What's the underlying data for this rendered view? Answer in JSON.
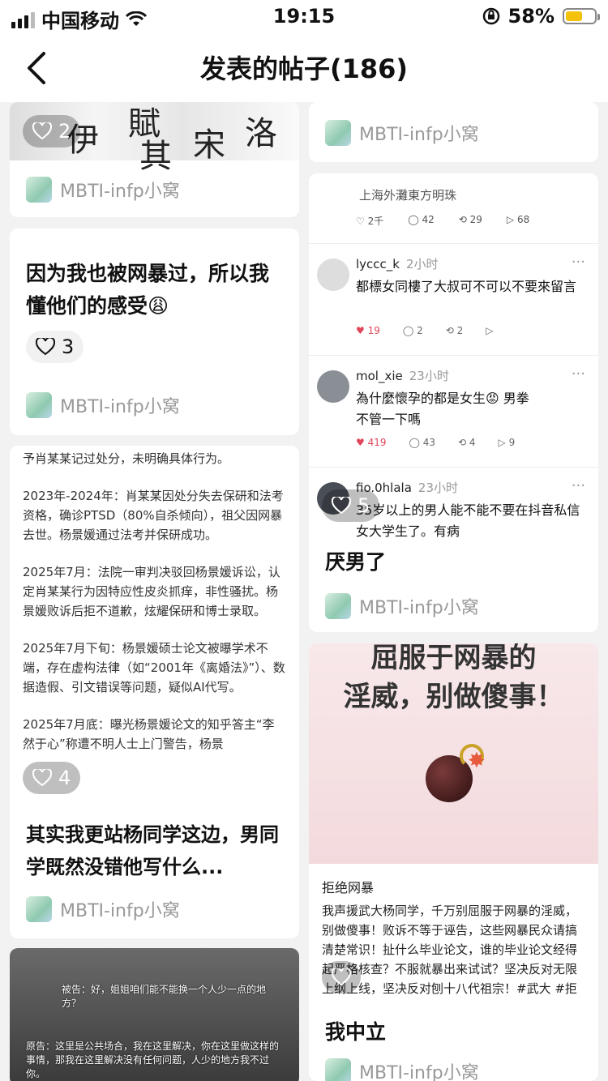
{
  "status": {
    "carrier": "中国移动",
    "time": "19:15",
    "battery": "58%",
    "battery_level": 0.58
  },
  "nav": {
    "title": "发表的帖子(186)"
  },
  "author": "MBTI-infp小窝",
  "left": {
    "card1": {
      "likes": "2",
      "calli": [
        "伊",
        "賦",
        "其",
        "宋",
        "洛"
      ]
    },
    "card2": {
      "title": "因为我也被网暴过，所以我懂他们的感受😩",
      "likes": "3"
    },
    "card3": {
      "doc": [
        "予肖某某记过处分，未明确具体行为。",
        "2023年-2024年：肖某某因处分失去保研和法考资格，确诊PTSD（80%自杀倾向），祖父因网暴去世。杨景媛通过法考并保研成功。",
        "2025年7月：法院一审判决驳回杨景媛诉讼，认定肖某某行为因特应性皮炎抓痒，非性骚扰。杨景媛败诉后拒不道歉，炫耀保研和博士录取。",
        "2025年7月下旬：杨景媛硕士论文被曝学术不端，存在虚构法律（如“2001年《离婚法》”）、数据造假、引文错误等问题，疑似AI代写。",
        "2025年7月底：曝光杨景媛论文的知乎答主“李然于心”称遭不明人士上门警告，杨景"
      ],
      "likes": "4",
      "title": "其实我更站杨同学这边，男同学既然没错他写什么..."
    },
    "card4": {
      "subtitles": [
        "被告：好，姐姐咱们能不能换一个人少一点的地方？",
        "原告：这里是公共场合，我在这里解决，你在这里做这样的事情，那我在这里解决没有任何问题，人少的地方我不过你。"
      ]
    }
  },
  "right": {
    "card1": {},
    "card2": {
      "source": "上海外灘東方明珠",
      "stats": [
        "2千",
        "42",
        "29",
        "68"
      ],
      "comments": [
        {
          "name": "lyccc_k",
          "time": "2小时",
          "text": "都標女同樓了大叔可不可以不要來留言",
          "stats": [
            "19",
            "2",
            "2"
          ]
        },
        {
          "name": "mol_xie",
          "time": "23小时",
          "text": "為什麼懷孕的都是女生😡 男拳不管一下嗎",
          "stats": [
            "419",
            "43",
            "4",
            "9"
          ]
        },
        {
          "name": "fio.0hlala",
          "time": "23小时",
          "text": "35岁以上的男人能不能不要在抖音私信女大学生了。有病",
          "stats": []
        }
      ],
      "likes": "5",
      "title": "厌男了"
    },
    "card3": {
      "image_text": [
        "屈服于网暴的",
        "淫威，别做傻事！"
      ],
      "topic": "拒绝网暴",
      "body": "我声援武大杨同学，千万别屈服于网暴的淫威，别做傻事！败诉不等于诬告，这些网暴民众请搞清楚常识！扯什么毕业论文，谁的毕业论文经得起严格核查？不服就暴出来试试？坚决反对无限上纲上线，坚决反对刨十八代祖宗！#武大 #拒绝网暴从我做起 #语言",
      "title": "我中立"
    }
  },
  "colors": {
    "like_red": "#e0455a",
    "muted": "#999999"
  },
  "icons": [
    "back-arrow-icon",
    "heart-icon",
    "comment-icon",
    "repost-icon",
    "share-icon",
    "plus-icon",
    "more-icon"
  ]
}
